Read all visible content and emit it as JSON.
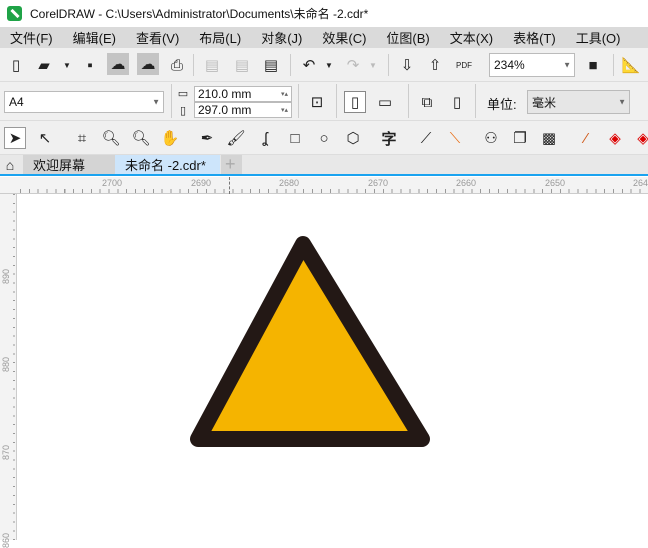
{
  "window": {
    "title": "CorelDRAW - C:\\Users\\Administrator\\Documents\\未命名 -2.cdr*"
  },
  "menu": [
    "文件(F)",
    "编辑(E)",
    "查看(V)",
    "布局(L)",
    "对象(J)",
    "效果(C)",
    "位图(B)",
    "文本(X)",
    "表格(T)",
    "工具(O)"
  ],
  "toolbar": {
    "zoom": "234%",
    "pdf_label": "PDF"
  },
  "propbar": {
    "page_size": "A4",
    "width": "210.0 mm",
    "height": "297.0 mm",
    "unit_label": "单位:",
    "unit": "毫米"
  },
  "toolbox": {
    "text_tool": "字"
  },
  "tabs": [
    {
      "label": "欢迎屏幕"
    },
    {
      "label": "未命名 -2.cdr*"
    }
  ],
  "rulers": {
    "horizontal": [
      "2700",
      "2690",
      "2680",
      "2670",
      "2660",
      "2650",
      "264"
    ],
    "vertical": [
      "890",
      "880",
      "870",
      "860"
    ]
  },
  "shape": {
    "fill": "#f5b400",
    "stroke": "#231815"
  }
}
